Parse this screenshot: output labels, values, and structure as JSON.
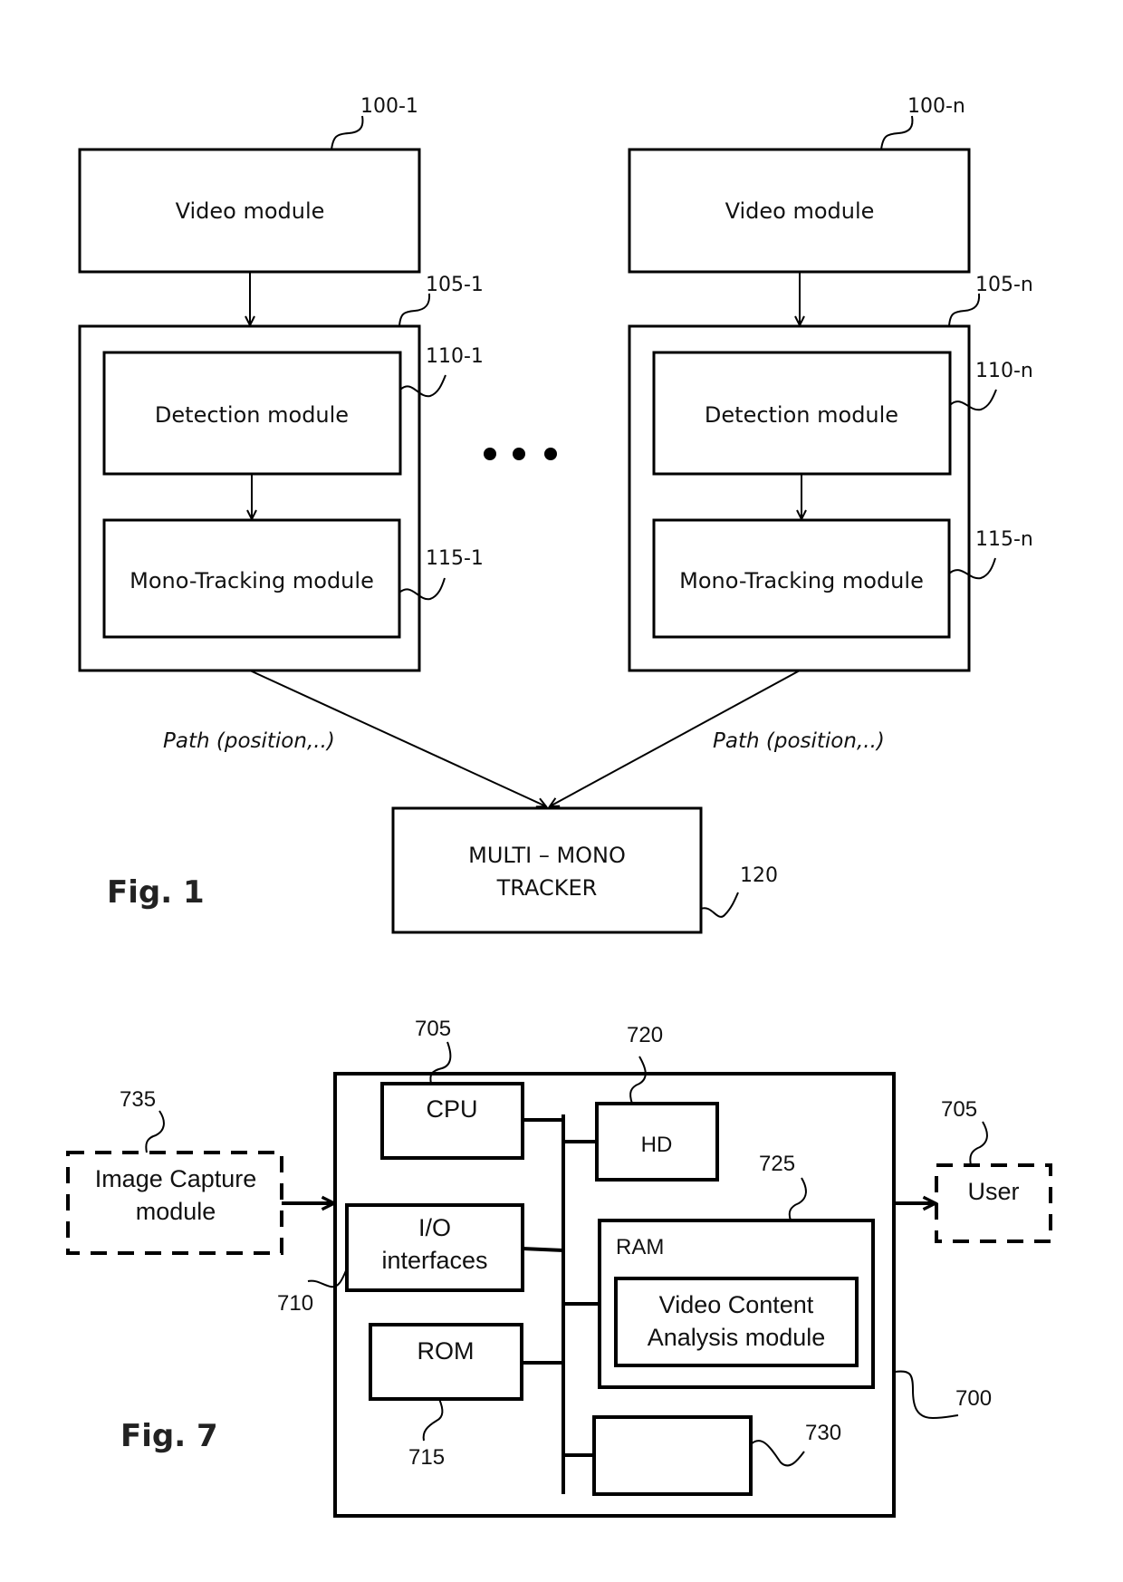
{
  "fig1": {
    "label": "Fig. 1",
    "left_chain": {
      "video_module": {
        "label": "Video module",
        "ref": "100-1"
      },
      "processing_unit": {
        "ref": "105-1"
      },
      "detection_module": {
        "label": "Detection module",
        "ref": "110-1"
      },
      "mono_tracking_module": {
        "label": "Mono-Tracking module",
        "ref": "115-1"
      },
      "path_label": "Path (position,..)"
    },
    "right_chain": {
      "video_module": {
        "label": "Video module",
        "ref": "100-n"
      },
      "processing_unit": {
        "ref": "105-n"
      },
      "detection_module": {
        "label": "Detection module",
        "ref": "110-n"
      },
      "mono_tracking_module": {
        "label": "Mono-Tracking module",
        "ref": "115-n"
      },
      "path_label": "Path (position,..)"
    },
    "ellipsis": "• • •",
    "multi_mono_tracker": {
      "line1": "MULTI – MONO",
      "line2": "TRACKER",
      "ref": "120"
    }
  },
  "fig7": {
    "label": "Fig. 7",
    "device": {
      "ref": "700"
    },
    "cpu": {
      "label": "CPU",
      "ref": "705"
    },
    "hd": {
      "label": "HD",
      "ref": "720"
    },
    "io": {
      "line1": "I/O",
      "line2": "interfaces",
      "ref": "710"
    },
    "rom": {
      "label": "ROM",
      "ref": "715"
    },
    "ram": {
      "label": "RAM",
      "ref": "725"
    },
    "vca": {
      "line1": "Video Content",
      "line2": "Analysis module"
    },
    "unit_730": {
      "ref": "730"
    },
    "image_capture": {
      "line1": "Image Capture",
      "line2": "module",
      "ref": "735"
    },
    "user": {
      "label": "User",
      "ref": "705"
    }
  }
}
